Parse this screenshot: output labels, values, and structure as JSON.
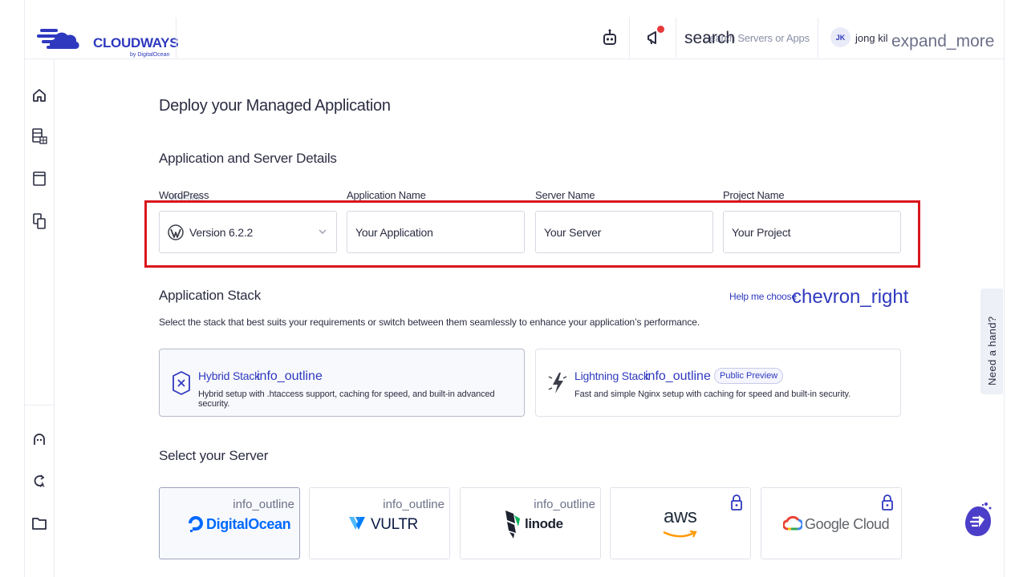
{
  "header": {
    "logo_text": "CLOUDWAYS",
    "logo_sub": "by DigitalOcean",
    "search_icon": "search",
    "search_placeholder": "Search Servers or Apps",
    "avatar_initials": "JK",
    "user_name": "jong kil",
    "expand_icon": "expand_more",
    "icons": [
      "bot-icon",
      "megaphone-icon"
    ]
  },
  "sidebar": {
    "top_icons": [
      "home-icon",
      "servers-icon",
      "applications-icon",
      "team-icon"
    ],
    "bottom_icons": [
      "support-icon",
      "addons-icon",
      "folder-icon"
    ]
  },
  "main": {
    "page_title": "Deploy your Managed Application",
    "details_title": "Application and Server Details",
    "labels": {
      "wordpress": "WordPress",
      "wordpress_overlap": "Version",
      "application_name": "Application Name",
      "server_name": "Server Name",
      "project_name": "Project Name"
    },
    "fields": {
      "version_value": "Version 6.2.2",
      "application_placeholder": "Your Application",
      "server_placeholder": "Your Server",
      "project_placeholder": "Your Project"
    },
    "stack": {
      "title": "Application Stack",
      "subtitle": "Select the stack that best suits your requirements or switch between them seamlessly to enhance your application’s performance.",
      "help_link": "Help me choose",
      "help_icon": "chevron_right",
      "cards": [
        {
          "name": "Hybrid Stack",
          "info_icon": "info_outline",
          "desc": "Hybrid setup with .htaccess support, caching for speed, and built-in advanced security.",
          "selected": true
        },
        {
          "name": "Lightning Stack",
          "info_icon": "info_outline",
          "badge": "Public Preview",
          "desc": "Fast and simple Nginx setup with caching for speed and built-in security.",
          "selected": false
        }
      ]
    },
    "server": {
      "title": "Select your Server",
      "cards": [
        {
          "name": "DigitalOcean",
          "info_icon": "info_outline",
          "color": "#0069ff",
          "locked": false,
          "selected": true
        },
        {
          "name": "VULTR",
          "info_icon": "info_outline",
          "color": "#0a1a44",
          "locked": false,
          "selected": false
        },
        {
          "name": "linode",
          "info_icon": "info_outline",
          "color": "#1d2230",
          "locked": false,
          "selected": false
        },
        {
          "name": "aws",
          "color": "#232f3e",
          "locked": true,
          "selected": false
        },
        {
          "name": "Google Cloud",
          "color": "#5f6368",
          "locked": true,
          "selected": false
        }
      ]
    }
  },
  "widgets": {
    "need_hand": "Need a hand?"
  },
  "colors": {
    "brand": "#2f39bf",
    "highlight": "#d9161c",
    "notification": "#e5393b"
  }
}
